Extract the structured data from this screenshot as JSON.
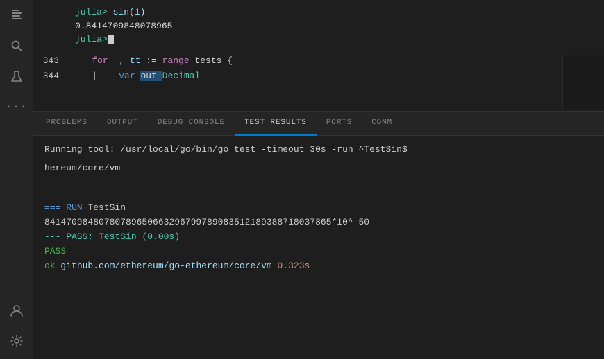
{
  "activityBar": {
    "icons": [
      {
        "name": "explorer-icon",
        "glyph": "⬜",
        "active": false
      },
      {
        "name": "search-icon",
        "glyph": "🔍",
        "active": false
      },
      {
        "name": "flask-icon",
        "glyph": "⚗",
        "active": false
      },
      {
        "name": "more-icon",
        "glyph": "···",
        "active": false
      }
    ],
    "bottomIcons": [
      {
        "name": "account-icon",
        "glyph": "👤",
        "active": false
      },
      {
        "name": "settings-icon",
        "glyph": "⚙",
        "active": false
      }
    ]
  },
  "terminal": {
    "line1_prompt": "julia>",
    "line1_cmd": " sin(1)",
    "line2_result": "0.8414709848078965",
    "line3_prompt": "julia>"
  },
  "editor": {
    "lines": [
      {
        "number": "343",
        "active": false,
        "tokens": [
          {
            "text": "    for ",
            "cls": "kw-for"
          },
          {
            "text": "_, tt ",
            "cls": "code-ident"
          },
          {
            "text": ":= ",
            "cls": "code-op"
          },
          {
            "text": "range ",
            "cls": "kw-range"
          },
          {
            "text": "tests {",
            "cls": "code-op"
          }
        ]
      },
      {
        "number": "344",
        "active": false,
        "tokens": [
          {
            "text": "    |    ",
            "cls": "code-op"
          },
          {
            "text": "var ",
            "cls": "kw-var"
          },
          {
            "text": "out ",
            "cls": "code-highlighted"
          },
          {
            "text": "Decimal",
            "cls": "code-type"
          }
        ]
      }
    ]
  },
  "panel": {
    "tabs": [
      {
        "id": "problems",
        "label": "PROBLEMS",
        "active": false
      },
      {
        "id": "output",
        "label": "OUTPUT",
        "active": false
      },
      {
        "id": "debug-console",
        "label": "DEBUG CONSOLE",
        "active": false
      },
      {
        "id": "test-results",
        "label": "TEST RESULTS",
        "active": true
      },
      {
        "id": "ports",
        "label": "PORTS",
        "active": false
      },
      {
        "id": "comm",
        "label": "COMM",
        "active": false
      }
    ],
    "content": {
      "runCmd": "Running tool: /usr/local/go/bin/go test -timeout 30s -run ^TestSin$",
      "runPath": "hereum/core/vm",
      "separator": "",
      "runLine": "=== RUN   TestSin",
      "resultNumber": "84147098480780789650663296799789083512189388718037865*10^-50",
      "passLine": "--- PASS: TestSin (0.00s)",
      "passWord": "PASS",
      "okLine_label": "ok",
      "okLine_path": "github.com/ethereum/go-ethereum/core/vm",
      "okLine_timing": "0.323s"
    }
  }
}
